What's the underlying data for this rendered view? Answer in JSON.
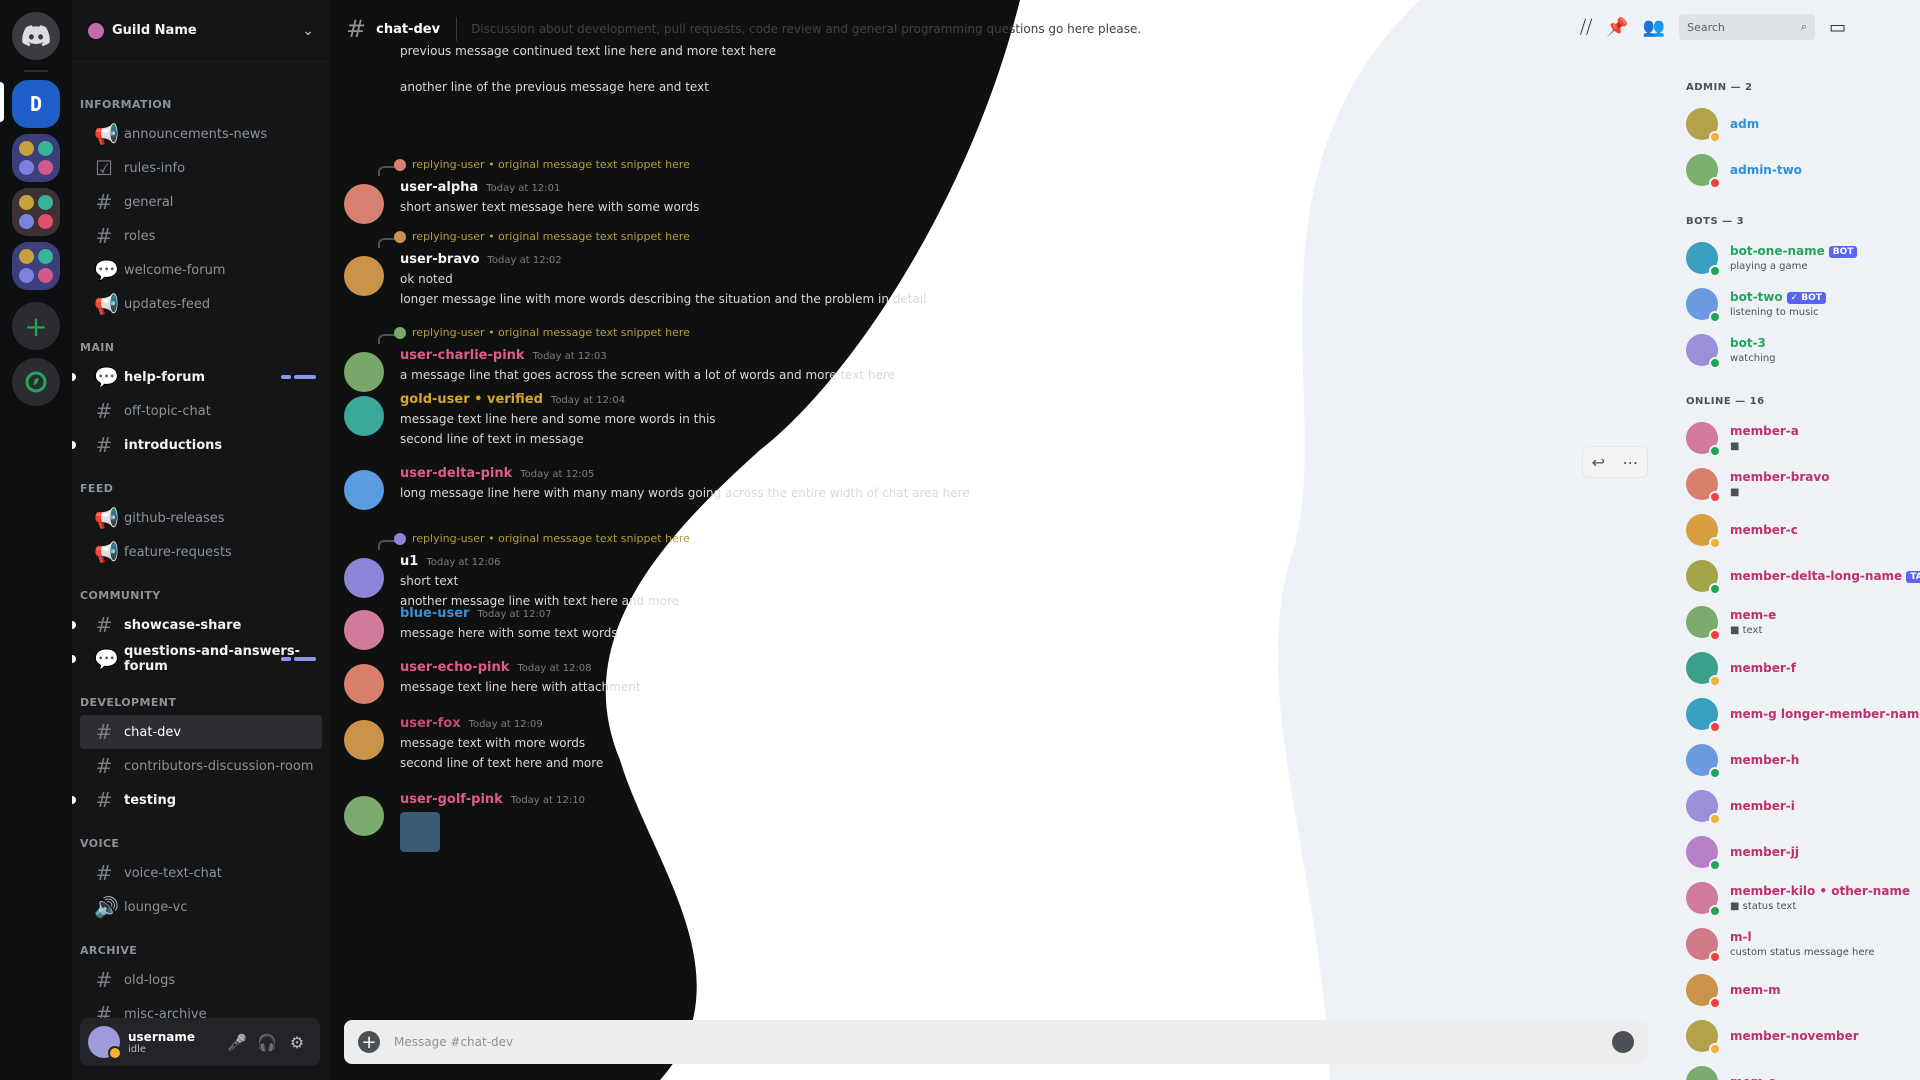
{
  "server_rail": {
    "home_label": "Discord",
    "servers": [
      {
        "name": "Server 1",
        "color": "#2f6fe0"
      },
      {
        "name": "Folder A",
        "colors": [
          "#c7a23a",
          "#39b39a",
          "#7c81e0",
          "#d05a8a"
        ]
      },
      {
        "name": "Folder B",
        "colors": [
          "#c7a23a",
          "#39b39a",
          "#7c81e0",
          "#e0506a"
        ]
      },
      {
        "name": "Folder C",
        "colors": [
          "#c7a23a",
          "#39b39a",
          "#7c81e0",
          "#d05a8a"
        ]
      }
    ],
    "add_label": "+",
    "explore_label": "Explore"
  },
  "guild": {
    "name": "Guild Name",
    "chevron": "v"
  },
  "channels": [
    {
      "type": "category",
      "label": "Information"
    },
    {
      "type": "announce",
      "label": "announcements-news"
    },
    {
      "type": "rules",
      "label": "rules-info"
    },
    {
      "type": "text",
      "label": "general"
    },
    {
      "type": "text",
      "label": "roles"
    },
    {
      "type": "forum",
      "label": "welcome-forum"
    },
    {
      "type": "announce",
      "label": "updates-feed"
    },
    {
      "type": "category",
      "label": "Main"
    },
    {
      "type": "forum",
      "label": "help-forum",
      "unread": true,
      "pills": true
    },
    {
      "type": "text",
      "label": "off-topic-chat"
    },
    {
      "type": "text",
      "label": "introductions",
      "unread": true
    },
    {
      "type": "category",
      "label": "Feed"
    },
    {
      "type": "announce",
      "label": "github-releases"
    },
    {
      "type": "announce",
      "label": "feature-requests"
    },
    {
      "type": "category",
      "label": "Community"
    },
    {
      "type": "text",
      "label": "showcase-share",
      "unread": true
    },
    {
      "type": "forum",
      "label": "questions-and-answers-forum",
      "unread": true,
      "pills": true
    },
    {
      "type": "category",
      "label": "Development"
    },
    {
      "type": "text",
      "label": "chat-dev",
      "active": true
    },
    {
      "type": "text",
      "label": "contributors-discussion-room"
    },
    {
      "type": "text",
      "label": "testing",
      "unread": true
    },
    {
      "type": "category",
      "label": "Voice"
    },
    {
      "type": "text",
      "label": "voice-text-chat"
    },
    {
      "type": "voice",
      "label": "lounge-vc"
    },
    {
      "type": "category",
      "label": "Archive"
    },
    {
      "type": "text",
      "label": "old-logs"
    },
    {
      "type": "text",
      "label": "misc-archive"
    }
  ],
  "user_panel": {
    "username": "username",
    "status": "idle",
    "mic_icon": "🎤",
    "headset_icon": "🎧",
    "settings_icon": "⚙"
  },
  "topbar": {
    "channel": "chat-dev",
    "topic": "Discussion about development, pull requests, code review and general programming questions go here please.",
    "search_placeholder": "Search"
  },
  "messages": [
    {
      "author": "",
      "reply": "",
      "time": "",
      "body": "previous message continued text line here and more text here",
      "color": "#d8d9da"
    },
    {
      "author": "",
      "reply": "",
      "time": "",
      "body": "another line of the previous message here and text",
      "color": "#d8d9da"
    },
    {
      "author": "user-alpha",
      "reply": "replying-user • original message text snippet here",
      "time": "Today at 12:01",
      "body": "short answer text message here with some words",
      "color": "#f2f3f5",
      "avatar": "#d98170"
    },
    {
      "author": "user-bravo",
      "reply": "replying-user • original message text snippet here",
      "time": "Today at 12:02",
      "body": "ok noted",
      "body2": "longer message line with more words describing the situation and the problem in detail",
      "color": "#f2f3f5",
      "avatar": "#c9934a"
    },
    {
      "author": "user-charlie-pink",
      "reply": "replying-user • original message text snippet here",
      "time": "Today at 12:03",
      "body": "a message line that goes across the screen with a lot of words and more text here",
      "color": "#e05a8c",
      "avatar": "#77a86a"
    },
    {
      "author": "gold-user • verified",
      "reply": "",
      "time": "Today at 12:04",
      "body": "message text line here and some more words in this",
      "body2": "second line of text in message",
      "color": "#d4a62a",
      "avatar": "#3aa89a"
    },
    {
      "author": "user-delta-pink",
      "reply": "",
      "time": "Today at 12:05",
      "body": "long message line here with many many words going across the entire width of chat area here",
      "color": "#e05a8c",
      "avatar": "#5b9be0"
    },
    {
      "author": "u1",
      "reply": "replying-user • original message text snippet here",
      "time": "Today at 12:06",
      "body": "short text",
      "body2": "another message line with text here and more",
      "color": "#f2f3f5",
      "avatar": "#8e84d8"
    },
    {
      "author": "blue-user",
      "reply": "",
      "time": "Today at 12:07",
      "body": "message here with some text words",
      "color": "#3d8fd9",
      "avatar": "#d07a9c"
    },
    {
      "author": "user-echo-pink",
      "reply": "",
      "time": "Today at 12:08",
      "body": "message text line here with attachment",
      "color": "#e05a8c",
      "avatar": "#d9806c"
    },
    {
      "author": "user-fox",
      "reply": "",
      "time": "Today at 12:09",
      "body": "message text with more words",
      "body2": "second line of text here and more",
      "color": "#c94a74",
      "avatar": "#c9934a"
    },
    {
      "author": "user-golf-pink",
      "reply": "",
      "time": "Today at 12:10",
      "body": "",
      "color": "#e05a8c",
      "avatar": "#7bab6c"
    }
  ],
  "composer": {
    "placeholder": "Message #chat-dev"
  },
  "hover_actions": {
    "reply_icon": "↩",
    "more_icon": "⋯"
  },
  "members": {
    "groups": [
      {
        "label": "Admin — 2",
        "members": [
          {
            "name": "adm",
            "color": "#2f8fe0",
            "avatar": "#b3a24a",
            "status": "idle"
          },
          {
            "name": "admin-two",
            "color": "#2f8fe0",
            "avatar": "#79b06c",
            "status": "dnd"
          }
        ]
      },
      {
        "label": "Bots — 3",
        "members": [
          {
            "name": "bot-one-name",
            "color": "#23a559",
            "avatar": "#3aa0c0",
            "status": "online",
            "tag": "BOT",
            "sub": "playing a game"
          },
          {
            "name": "bot-two",
            "color": "#23a559",
            "avatar": "#6a9be0",
            "status": "online",
            "tag": "✓ BOT",
            "sub": "listening to music"
          },
          {
            "name": "bot-3",
            "color": "#23a559",
            "avatar": "#9a8fd8",
            "status": "online",
            "sub": "watching"
          }
        ]
      },
      {
        "label": "Online — 16",
        "members": [
          {
            "name": "member-a",
            "color": "#c0306a",
            "avatar": "#d07a9c",
            "status": "online",
            "sub": "■"
          },
          {
            "name": "member-bravo",
            "color": "#c0306a",
            "avatar": "#d9806c",
            "status": "dnd",
            "sub": "■"
          },
          {
            "name": "member-c",
            "color": "#c0306a",
            "avatar": "#d6a040",
            "status": "idle"
          },
          {
            "name": "member-delta-long-name",
            "color": "#c0306a",
            "avatar": "#a3a44a",
            "status": "online",
            "tag": "TAG"
          },
          {
            "name": "mem-e",
            "color": "#c0306a",
            "avatar": "#7bab6c",
            "status": "dnd",
            "sub": "■ text"
          },
          {
            "name": "member-f",
            "color": "#c0306a",
            "avatar": "#3aa08a",
            "status": "idle"
          },
          {
            "name": "mem-g longer-member-name",
            "color": "#c0306a",
            "avatar": "#3aa0c0",
            "status": "dnd"
          },
          {
            "name": "member-h",
            "color": "#c0306a",
            "avatar": "#6a9be0",
            "status": "online"
          },
          {
            "name": "member-i",
            "color": "#c0306a",
            "avatar": "#9a8fd8",
            "status": "idle"
          },
          {
            "name": "member-jj",
            "color": "#c0306a",
            "avatar": "#b780c8",
            "status": "online"
          },
          {
            "name": "member-kilo • other-name",
            "color": "#c0306a",
            "avatar": "#d07a9c",
            "status": "mobile",
            "sub": "■ status text"
          },
          {
            "name": "m-l",
            "color": "#c0306a",
            "avatar": "#d07a88",
            "status": "dnd",
            "sub": "custom status message here"
          },
          {
            "name": "mem-m",
            "color": "#c0306a",
            "avatar": "#c9934a",
            "status": "dnd"
          },
          {
            "name": "member-november",
            "color": "#c0306a",
            "avatar": "#b3a24a",
            "status": "idle"
          },
          {
            "name": "mem-o",
            "color": "#c0306a",
            "avatar": "#7bab6c",
            "status": "online"
          }
        ]
      }
    ]
  },
  "colors": {
    "online": "#23a559",
    "idle": "#f0b232",
    "dnd": "#f23f43",
    "mobile": "#23a559"
  }
}
